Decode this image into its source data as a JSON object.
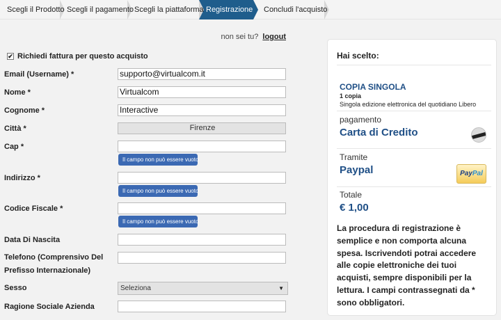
{
  "steps": [
    {
      "label": "Scegli il Prodotto"
    },
    {
      "label": "Scegli il pagamento"
    },
    {
      "label": "Scegli la piattaforma"
    },
    {
      "label": "Registrazione"
    },
    {
      "label": "Concludi l'acquisto"
    }
  ],
  "active_step": "Registrazione",
  "header": {
    "not_you": "non sei tu?",
    "logout": "logout"
  },
  "form": {
    "invoice_label": "Richiedi fattura per questo acquisto",
    "invoice_checked": true,
    "invoice_mark": "✔",
    "email": {
      "label": "Email (Username) *",
      "value": "supporto@virtualcom.it"
    },
    "nome": {
      "label": "Nome *",
      "value": "Virtualcom"
    },
    "cognome": {
      "label": "Cognome *",
      "value": "Interactive"
    },
    "citta": {
      "label": "Città *",
      "value": "Firenze"
    },
    "cap": {
      "label": "Cap *",
      "value": "",
      "error": "Il campo non può essere vuoto"
    },
    "indirizzo": {
      "label": "Indirizzo *",
      "value": "",
      "error": "Il campo non può essere vuoto"
    },
    "codice_fiscale": {
      "label": "Codice Fiscale *",
      "value": "",
      "error": "Il campo non può essere vuoto"
    },
    "data_nascita": {
      "label": "Data Di Nascita",
      "value": ""
    },
    "telefono": {
      "label_line1": "Telefono (Comprensivo Del",
      "label_line2": "Prefisso Internazionale)",
      "value": ""
    },
    "sesso": {
      "label": "Sesso",
      "selected": "Seleziona",
      "caret": "▼"
    },
    "ragione_sociale": {
      "label": "Ragione Sociale Azienda",
      "value": ""
    }
  },
  "summary": {
    "title": "Hai scelto:",
    "product": "COPIA SINGOLA",
    "copies": "1 copia",
    "description": "Singola edizione elettronica del quotidiano Libero",
    "payment_label": "pagamento",
    "payment_value": "Carta di Credito",
    "via_label": "Tramite",
    "via_value": "Paypal",
    "paypal_logo_part1": "Pay",
    "paypal_logo_part2": "Pal",
    "total_label": "Totale",
    "total_value": "€ 1,00",
    "info": "La procedura di registrazione è semplice e non comporta alcuna spesa. Iscrivendoti potrai accedere alle copie elettroniche dei tuoi acquisti, sempre disponibili per la lettura. I campi contrassegnati da * sono obbligatori."
  },
  "colors": {
    "accent": "#1f5d8c",
    "tip": "#3b69b3",
    "link_blue": "#1f4f86"
  },
  "icons": {
    "card": "credit-card-icon",
    "paypal": "paypal-logo-icon",
    "checkbox": "checkbox-icon"
  }
}
